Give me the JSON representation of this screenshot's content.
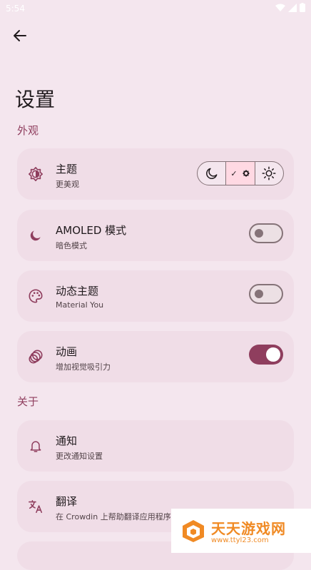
{
  "status_bar": {
    "time": "5:54"
  },
  "page": {
    "title": "设置"
  },
  "sections": {
    "appearance": "外观",
    "about": "关于"
  },
  "items": [
    {
      "title": "主题",
      "subtitle": "更美观"
    },
    {
      "title": "AMOLED 模式",
      "subtitle": "暗色模式",
      "toggle_on": false
    },
    {
      "title": "动态主题",
      "subtitle": "Material You",
      "toggle_on": false
    },
    {
      "title": "动画",
      "subtitle": "增加视觉吸引力",
      "toggle_on": true
    },
    {
      "title": "通知",
      "subtitle": "更改通知设置"
    },
    {
      "title": "翻译",
      "subtitle": "在 Crowdin 上帮助翻译应用程序"
    }
  ],
  "theme_selector": {
    "options": [
      "dark",
      "auto",
      "light"
    ],
    "selected": "auto",
    "selected_mark": "✓"
  },
  "watermark": {
    "text": "天天游戏网",
    "url": "www.ttyl23.com"
  },
  "colors": {
    "accent": "#8f3e5e",
    "background": "#f4e6ee",
    "card": "#f0dde7"
  }
}
